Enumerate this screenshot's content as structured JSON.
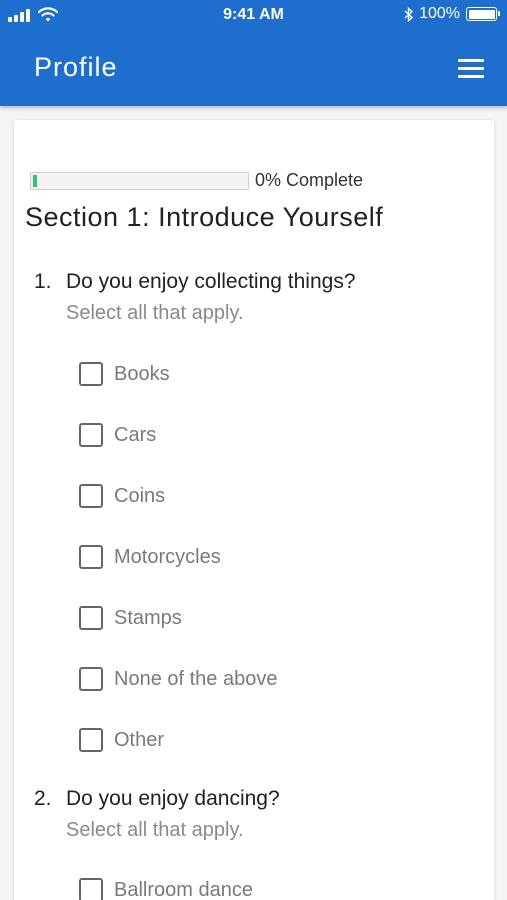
{
  "status_bar": {
    "time": "9:41 AM",
    "battery": "100%"
  },
  "app_bar": {
    "title": "Profile"
  },
  "progress": {
    "value": 0.02,
    "label": "0% Complete"
  },
  "section": {
    "title": "Section 1: Introduce Yourself"
  },
  "questions": [
    {
      "number": "1.",
      "text": "Do you enjoy collecting things?",
      "hint": "Select all that apply.",
      "options": [
        "Books",
        "Cars",
        "Coins",
        "Motorcycles",
        "Stamps",
        "None of the above",
        "Other"
      ]
    },
    {
      "number": "2.",
      "text": "Do you enjoy dancing?",
      "hint": "Select all that apply.",
      "options": [
        "Ballroom dance"
      ]
    }
  ],
  "colors": {
    "app_bar": "#1e6fcd",
    "progress": "#2ec56d"
  }
}
